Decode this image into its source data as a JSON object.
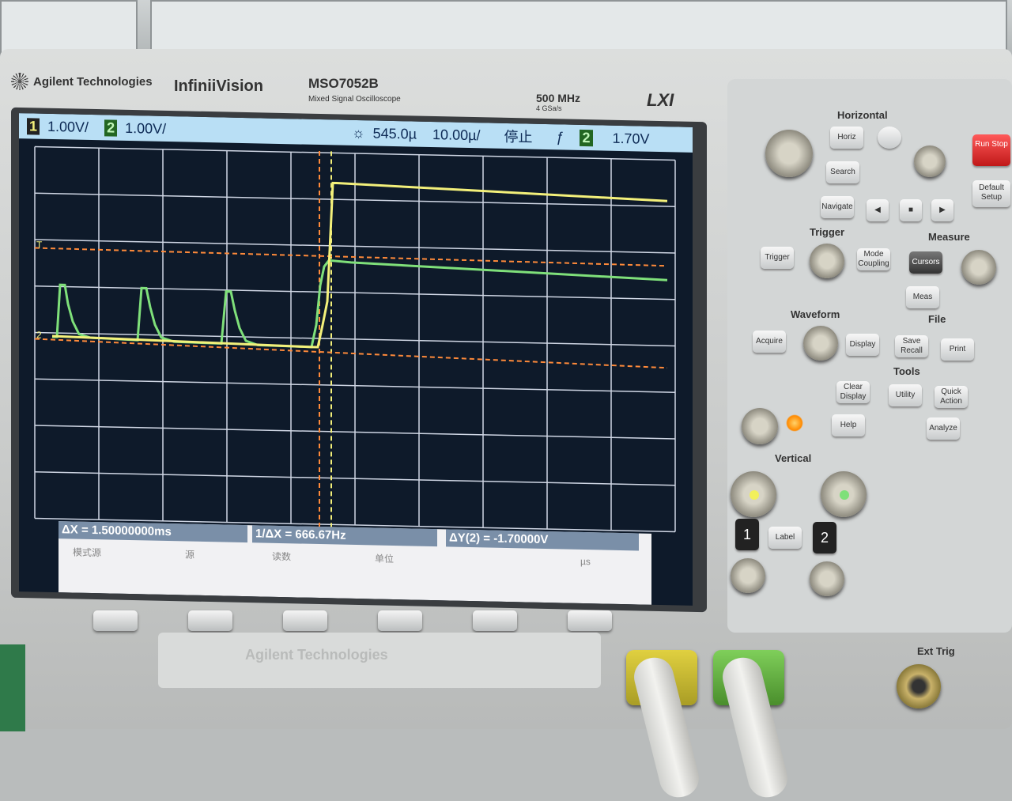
{
  "header": {
    "brand": "Agilent Technologies",
    "series": "InfiniiVision",
    "model": "MSO7052B",
    "model_sub": "Mixed Signal Oscilloscope",
    "bandwidth": "500 MHz",
    "sample_rate": "4 GSa/s",
    "lxi": "LXI"
  },
  "status_bar": {
    "ch1_num": "1",
    "ch1_scale": "1.00V/",
    "ch2_num": "2",
    "ch2_scale": "1.00V/",
    "delay": "545.0µ",
    "time_scale": "10.00µ/",
    "run_state": "停止",
    "trigger_ch": "2",
    "trigger_level": "1.70V"
  },
  "measurements": {
    "delta_x": "ΔX = 1.50000000ms",
    "inv_delta_x": "1/ΔX = 666.67Hz",
    "delta_y": "ΔY(2) = -1.70000V"
  },
  "softkey_labels": [
    "模式源",
    "源",
    "读数",
    "单位",
    "µs"
  ],
  "panel": {
    "horizontal": "Horizontal",
    "trigger": "Trigger",
    "measure": "Measure",
    "waveform": "Waveform",
    "file": "File",
    "tools": "Tools",
    "vertical": "Vertical",
    "ext_trig": "Ext Trig",
    "buttons": {
      "horiz": "Horiz",
      "search": "Search",
      "navigate": "Navigate",
      "trigger": "Trigger",
      "mode_coupling": "Mode Coupling",
      "cursors": "Cursors",
      "meas": "Meas",
      "acquire": "Acquire",
      "display": "Display",
      "save_recall": "Save Recall",
      "print": "Print",
      "clear_display": "Clear Display",
      "utility": "Utility",
      "quick_action": "Quick Action",
      "help": "Help",
      "analyze": "Analyze",
      "label": "Label",
      "default_setup": "Default Setup",
      "run_stop": "Run Stop"
    },
    "ch1_label": "1",
    "ch2_label": "2"
  },
  "bottom_logo": "Agilent Technologies",
  "colors": {
    "ch1": "#f3f07a",
    "ch2": "#7fe07a",
    "grid": "#cfd6e4",
    "screen_bg": "#0e1a2a",
    "status_bg": "#b9dff5",
    "cursor": "#ff8a3a"
  }
}
